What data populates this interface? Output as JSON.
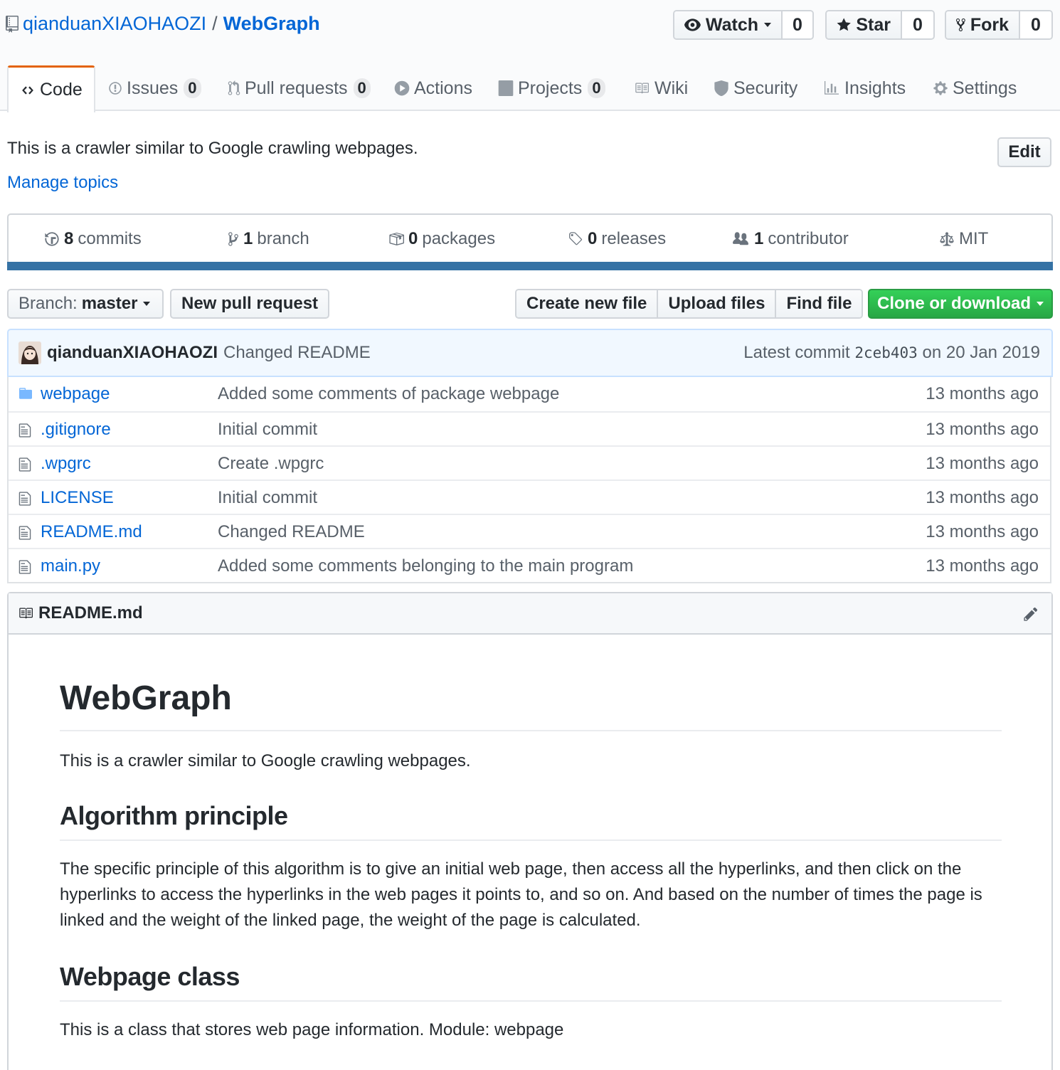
{
  "repo": {
    "owner": "qianduanXIAOHAOZI",
    "separator": "/",
    "name": "WebGraph"
  },
  "social": {
    "watch_label": "Watch",
    "watch_count": "0",
    "star_label": "Star",
    "star_count": "0",
    "fork_label": "Fork",
    "fork_count": "0"
  },
  "tabs": [
    {
      "label": "Code",
      "icon": "code-icon",
      "selected": true
    },
    {
      "label": "Issues",
      "count": "0",
      "icon": "issue-icon"
    },
    {
      "label": "Pull requests",
      "count": "0",
      "icon": "pull-request-icon"
    },
    {
      "label": "Actions",
      "icon": "play-icon"
    },
    {
      "label": "Projects",
      "count": "0",
      "icon": "project-icon"
    },
    {
      "label": "Wiki",
      "icon": "book-icon"
    },
    {
      "label": "Security",
      "icon": "shield-icon"
    },
    {
      "label": "Insights",
      "icon": "graph-icon"
    },
    {
      "label": "Settings",
      "icon": "gear-icon"
    }
  ],
  "about": {
    "description": "This is a crawler similar to Google crawling webpages.",
    "manage_topics": "Manage topics",
    "edit_label": "Edit"
  },
  "summary": {
    "commits_count": "8",
    "commits_label": "commits",
    "branch_count": "1",
    "branch_label": "branch",
    "packages_count": "0",
    "packages_label": "packages",
    "releases_count": "0",
    "releases_label": "releases",
    "contributor_count": "1",
    "contributor_label": "contributor",
    "license": "MIT",
    "language_color": "#3572A5"
  },
  "file_nav": {
    "branch_prefix": "Branch:",
    "branch_name": "master",
    "new_pull_request": "New pull request",
    "create_new_file": "Create new file",
    "upload_files": "Upload files",
    "find_file": "Find file",
    "clone_or_download": "Clone or download"
  },
  "latest_commit": {
    "author": "qianduanXIAOHAOZI",
    "message": "Changed README",
    "prefix": "Latest commit",
    "sha": "2ceb403",
    "date": "on 20 Jan 2019"
  },
  "files": [
    {
      "name": "webpage",
      "type": "folder",
      "message": "Added some comments of package webpage",
      "age": "13 months ago"
    },
    {
      "name": ".gitignore",
      "type": "file",
      "message": "Initial commit",
      "age": "13 months ago"
    },
    {
      "name": ".wpgrc",
      "type": "file",
      "message": "Create .wpgrc",
      "age": "13 months ago"
    },
    {
      "name": "LICENSE",
      "type": "file",
      "message": "Initial commit",
      "age": "13 months ago"
    },
    {
      "name": "README.md",
      "type": "file",
      "message": "Changed README",
      "age": "13 months ago"
    },
    {
      "name": "main.py",
      "type": "file",
      "message": "Added some comments belonging to the main program",
      "age": "13 months ago"
    }
  ],
  "readme": {
    "filename": "README.md",
    "h1": "WebGraph",
    "intro": "This is a crawler similar to Google crawling webpages.",
    "h2_algorithm": "Algorithm principle",
    "algorithm_text": "The specific principle of this algorithm is to give an initial web page, then access all the hyperlinks, and then click on the hyperlinks to access the hyperlinks in the web pages it points to, and so on. And based on the number of times the page is linked and the weight of the linked page, the weight of the page is calculated.",
    "h2_webpage": "Webpage class",
    "webpage_text": "This is a class that stores web page information. Module: webpage"
  }
}
